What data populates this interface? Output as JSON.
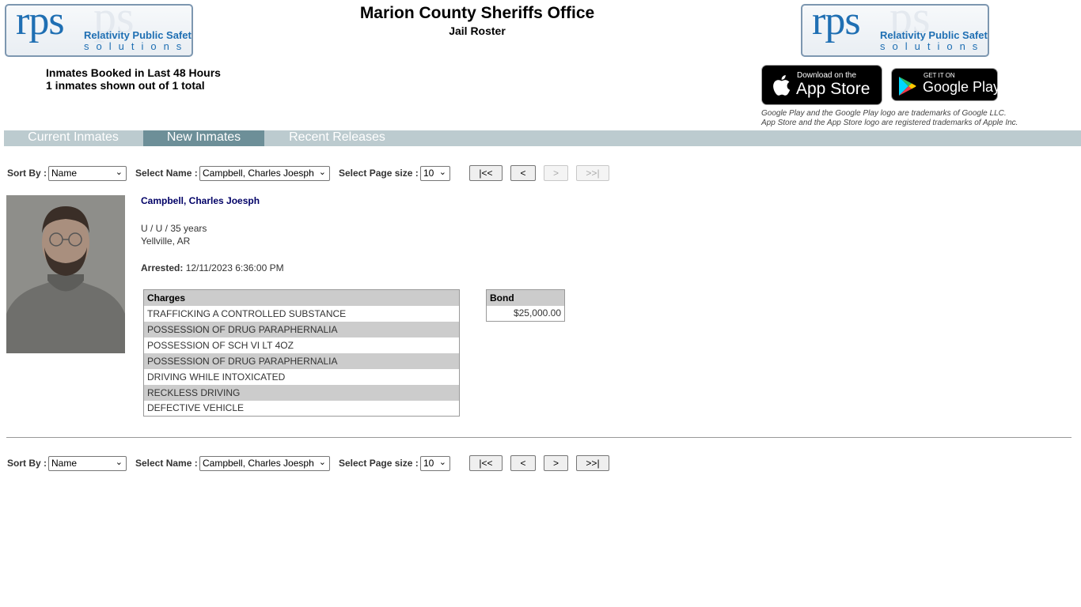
{
  "header": {
    "title": "Marion County Sheriffs Office",
    "subtitle": "Jail Roster",
    "logo_text": "rps",
    "logo_line1": "Relativity Public Safety",
    "logo_line2": "solutions"
  },
  "summary": {
    "line1": "Inmates Booked in Last 48 Hours",
    "line2": "1 inmates shown out of 1 total"
  },
  "stores": {
    "apple_small": "Download on the",
    "apple_big": "App Store",
    "google_small": "GET IT ON",
    "google_big": "Google Play",
    "trademark1": "Google Play and the Google Play logo are trademarks of Google LLC.",
    "trademark2": "App Store and the App Store logo are registered trademarks of Apple Inc."
  },
  "tabs": [
    {
      "label": "Current Inmates",
      "active": false
    },
    {
      "label": "New Inmates",
      "active": true
    },
    {
      "label": "Recent Releases",
      "active": false
    }
  ],
  "controls": {
    "sort_label": "Sort By :",
    "sort_value": "Name",
    "name_label": "Select Name :",
    "name_value": "Campbell, Charles Joesph",
    "page_size_label": "Select Page size :",
    "page_size_value": "10",
    "first": "|<<",
    "prev": "<",
    "next": ">",
    "last": ">>|"
  },
  "inmate": {
    "name": "Campbell, Charles Joesph",
    "demographics": "U / U / 35 years",
    "location": "Yellville, AR",
    "arrested_label": "Arrested:",
    "arrested_value": "12/11/2023 6:36:00 PM",
    "charges_header": "Charges",
    "charges": [
      "TRAFFICKING A CONTROLLED SUBSTANCE",
      "POSSESSION OF DRUG PARAPHERNALIA",
      "POSSESSION OF SCH VI LT 4OZ",
      "POSSESSION OF DRUG PARAPHERNALIA",
      "DRIVING WHILE INTOXICATED",
      "RECKLESS DRIVING",
      "DEFECTIVE VEHICLE"
    ],
    "bond_header": "Bond",
    "bond_value": "$25,000.00"
  },
  "colors": {
    "tab_bar": "#bccbcf",
    "tab_active": "#6d8f98",
    "logo_blue": "#1f6fb3",
    "name_color": "#000066"
  }
}
